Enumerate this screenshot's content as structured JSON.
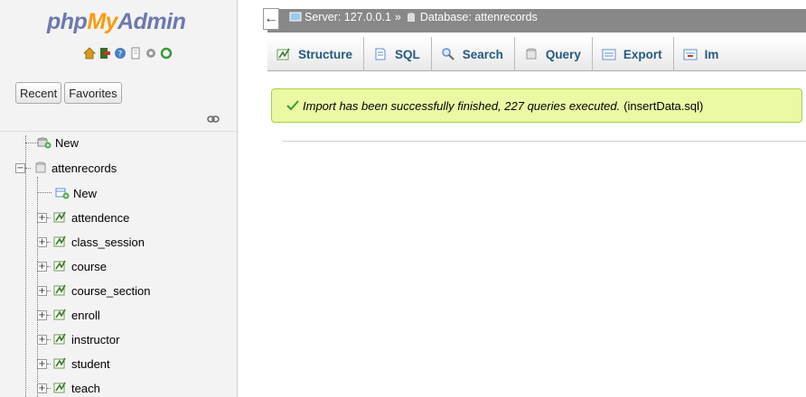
{
  "sidebar": {
    "logo": {
      "php": "php",
      "my": "My",
      "admin": "Admin"
    },
    "quick_icons": [
      "home-icon",
      "exit-icon",
      "help-icon",
      "docs-icon",
      "settings-icon",
      "reload-icon"
    ],
    "nav_buttons": {
      "recent": "Recent",
      "favorites": "Favorites"
    },
    "tree": {
      "new": "New",
      "database": "attenrecords",
      "db_new": "New",
      "tables": [
        "attendence",
        "class_session",
        "course",
        "course_section",
        "enroll",
        "instructor",
        "student",
        "teach"
      ]
    }
  },
  "breadcrumb": {
    "server": "Server: 127.0.0.1",
    "separator": "»",
    "database": "Database: attenrecords"
  },
  "tabs": {
    "structure": "Structure",
    "sql": "SQL",
    "search": "Search",
    "query": "Query",
    "export": "Export",
    "import": "Im"
  },
  "message": {
    "text": "Import has been successfully finished, 227 queries executed.",
    "file": "(insertData.sql)"
  },
  "colors": {
    "accent": "#235a81",
    "success_bg": "#ebf8a4",
    "success_border": "#a2d246",
    "topbar": "#888888"
  }
}
